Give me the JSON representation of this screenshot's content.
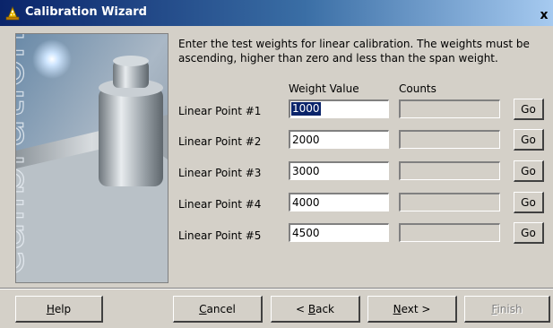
{
  "window": {
    "title": "Calibration Wizard",
    "close_label": "x"
  },
  "image_panel": {
    "watermark": "calibration"
  },
  "instructions": "Enter the test weights for linear calibration. The weights must be ascending, higher than zero and less than the span weight.",
  "columns": {
    "weight": "Weight Value",
    "counts": "Counts"
  },
  "rows": [
    {
      "label": "Linear Point #1",
      "weight": "1000",
      "counts": "",
      "go": "Go"
    },
    {
      "label": "Linear Point #2",
      "weight": "2000",
      "counts": "",
      "go": "Go"
    },
    {
      "label": "Linear Point #3",
      "weight": "3000",
      "counts": "",
      "go": "Go"
    },
    {
      "label": "Linear Point #4",
      "weight": "4000",
      "counts": "",
      "go": "Go"
    },
    {
      "label": "Linear Point #5",
      "weight": "4500",
      "counts": "",
      "go": "Go"
    }
  ],
  "buttons": {
    "help": {
      "first": "H",
      "rest": "elp"
    },
    "cancel": {
      "first": "C",
      "rest": "ancel"
    },
    "back": {
      "pre": "< ",
      "first": "B",
      "rest": "ack"
    },
    "next": {
      "first": "N",
      "rest": "ext >"
    },
    "finish": {
      "first": "F",
      "rest": "inish"
    }
  },
  "colors": {
    "title_start": "#0a246a",
    "title_end": "#a6caf0",
    "face": "#d4d0c8",
    "selection": "#0a246a"
  }
}
